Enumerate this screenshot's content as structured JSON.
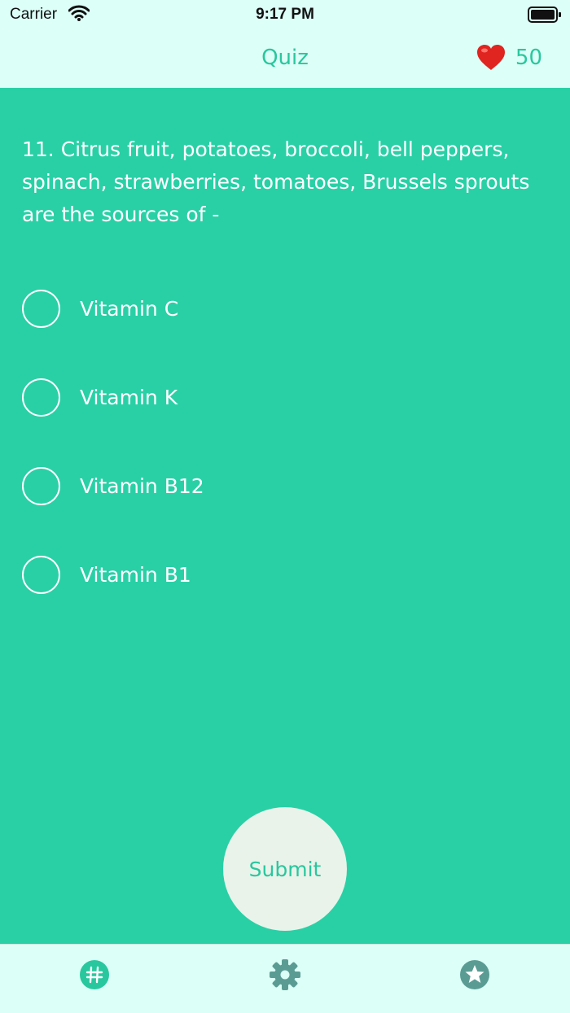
{
  "status_bar": {
    "carrier": "Carrier",
    "time": "9:17 PM"
  },
  "header": {
    "title": "Quiz",
    "lives": "50"
  },
  "question": {
    "text": "11. Citrus fruit, potatoes, broccoli, bell peppers, spinach, strawberries, tomatoes, Brussels sprouts are the sources of -"
  },
  "options": [
    {
      "label": "Vitamin C"
    },
    {
      "label": "Vitamin K"
    },
    {
      "label": "Vitamin B12"
    },
    {
      "label": "Vitamin B1"
    }
  ],
  "submit_label": "Submit",
  "tabs": [
    {
      "icon": "hashtag-icon",
      "selected": true
    },
    {
      "icon": "gear-icon",
      "selected": false
    },
    {
      "icon": "star-icon",
      "selected": false
    }
  ],
  "colors": {
    "background": "#29d0a6",
    "bar_background": "#dcfff7",
    "accent": "#29c79e",
    "inactive_icon": "#5a9c94",
    "submit_background": "#e9f3ea"
  }
}
